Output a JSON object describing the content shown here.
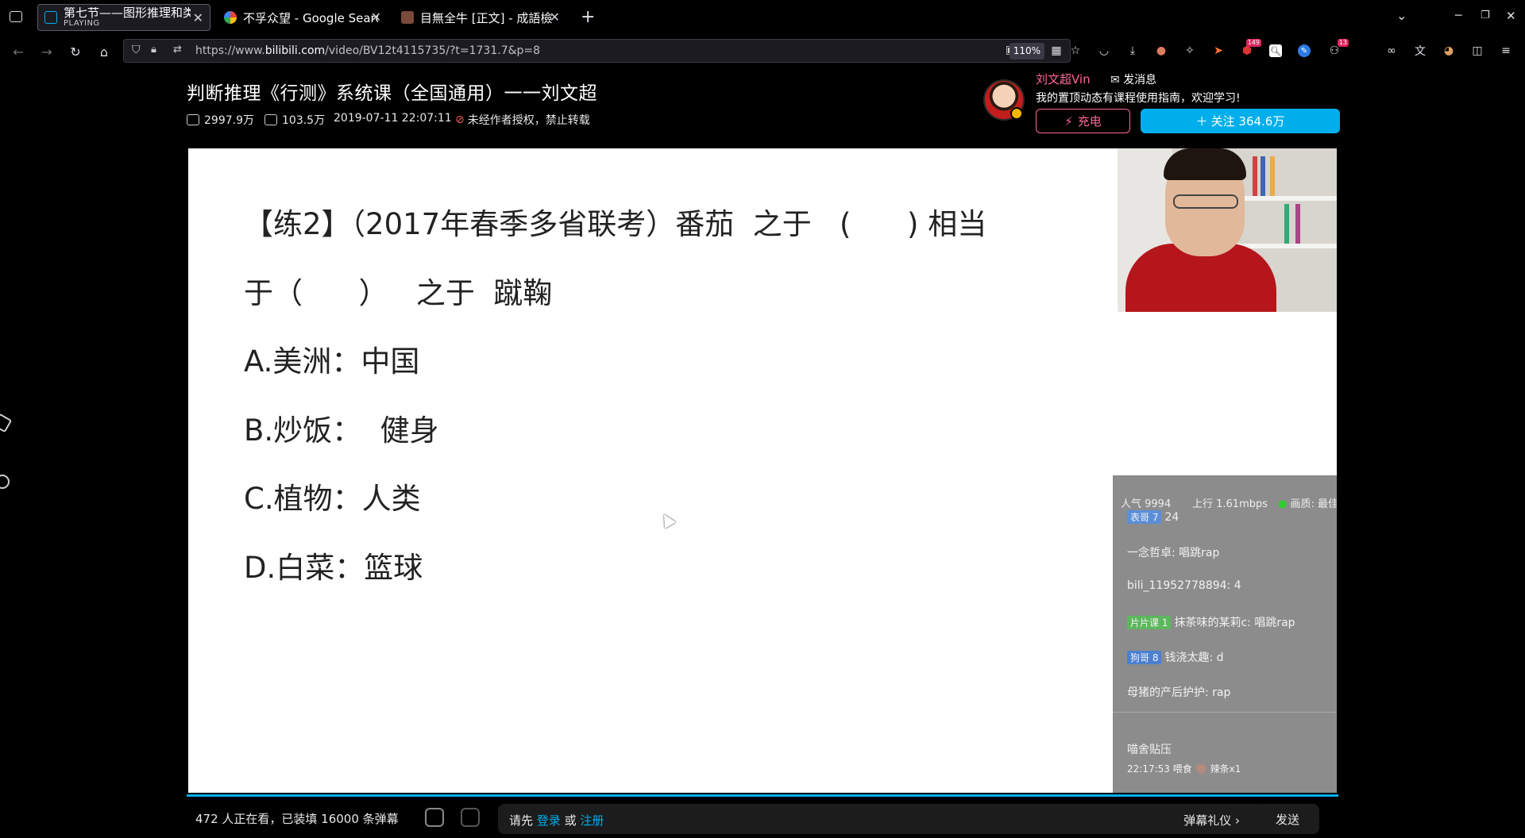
{
  "browser": {
    "tabs": [
      {
        "title": "第七节——图形推理和类",
        "subtitle": "PLAYING",
        "icon": "bilibili-icon",
        "active": true
      },
      {
        "title": "不孚众望 - Google Search",
        "icon": "google-icon",
        "active": false
      },
      {
        "title": "目無全牛 [正文] - 成語檢",
        "icon": "dictionary-icon",
        "active": false
      }
    ],
    "new_tab": "+",
    "url_prefix": "https://www.",
    "url_domain": "bilibili.com",
    "url_path": "/video/BV12t4115735/?t=1731.7&p=8",
    "zoom": "110%",
    "badges": {
      "ext1": "149",
      "ext2": "13"
    }
  },
  "video_info": {
    "title": "判断推理《行测》系统课（全国通用）一一刘文超",
    "views": "2997.9万",
    "danmaku_count": "103.5万",
    "date": "2019-07-11 22:07:11",
    "copyright": "未经作者授权，禁止转载"
  },
  "uploader": {
    "name": "刘文超Vin",
    "message_label": "发消息",
    "description": "我的置顶动态有课程使用指南，欢迎学习!",
    "charge_label": "充电",
    "follow_label": "关注 364.6万"
  },
  "slide": {
    "line1": "【练2】（2017年春季多省联考）番茄  之于   (      ) 相当",
    "line2": "于（      ）   之于  蹴鞠",
    "options": [
      "A.美洲：中国",
      "B.炒饭：  健身",
      "C.植物：人类",
      "D.白菜：篮球"
    ]
  },
  "live_panel": {
    "popularity": "人气 9994",
    "upload_speed": "上行 1.61mbps",
    "quality": "画质: 最佳",
    "messages": [
      {
        "level": "",
        "user": "",
        "text": "24"
      },
      {
        "level": "",
        "user": "一念哲卓:",
        "text": "唱跳rap"
      },
      {
        "level": "",
        "user": "bili_11952778894:",
        "text": "4"
      },
      {
        "level": "片片课 1",
        "user": "抹茶味的某莉c:",
        "text": "唱跳rap"
      },
      {
        "level": "狗哥 8",
        "user": "钱浇太趣:",
        "text": "d"
      },
      {
        "level": "",
        "user": "母猪的产后护护:",
        "text": "rap"
      }
    ],
    "footer_title": "喵舍贴压",
    "footer_time": "22:17:53 喂食",
    "footer_gift": "辣条x1"
  },
  "bottom": {
    "viewers": "472 人正在看，已装填 16000 条弹幕",
    "prompt_before": "请先 ",
    "login": "登录",
    "or": " 或 ",
    "register": "注册",
    "gift_label": "弹幕礼仪 ›",
    "send_label": "发送"
  },
  "colors": {
    "accent": "#00aeec",
    "pink": "#ff6699"
  }
}
